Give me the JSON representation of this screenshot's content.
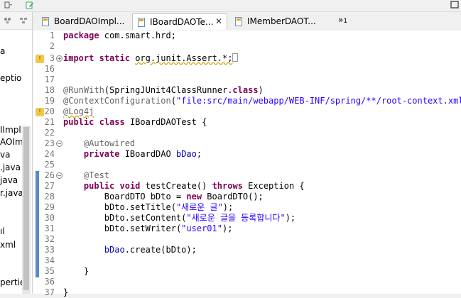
{
  "left_panel": {
    "items": [
      "a",
      "eptio",
      "IImpl.",
      "AOIm",
      "va",
      ".java",
      "java",
      "r.java",
      "ıl",
      "xml",
      "pertie"
    ]
  },
  "tabs": [
    {
      "label": "BoardDAOImpl...",
      "active": false
    },
    {
      "label": "IBoardDAOTe...",
      "active": true,
      "close": "✕"
    },
    {
      "label": "IMemberDAOT...",
      "active": false
    }
  ],
  "tab_overflow": {
    "symbol": "»",
    "count": "1"
  },
  "editor": {
    "lines": [
      {
        "num": "1"
      },
      {
        "num": "2"
      },
      {
        "num": "3"
      },
      {
        "num": "16"
      },
      {
        "num": "17"
      },
      {
        "num": "18"
      },
      {
        "num": "19"
      },
      {
        "num": "20"
      },
      {
        "num": "21"
      },
      {
        "num": "22"
      },
      {
        "num": "23"
      },
      {
        "num": "24"
      },
      {
        "num": "25"
      },
      {
        "num": "26"
      },
      {
        "num": "27"
      },
      {
        "num": "28"
      },
      {
        "num": "29"
      },
      {
        "num": "30"
      },
      {
        "num": "31"
      },
      {
        "num": "32"
      },
      {
        "num": "33"
      },
      {
        "num": "34"
      },
      {
        "num": "35"
      },
      {
        "num": "36"
      },
      {
        "num": "37"
      }
    ],
    "code": {
      "l1_kw": "package",
      "l1_rest": " com.smart.hrd;",
      "l3_kw1": "import",
      "l3_kw2": "static",
      "l3_rest": "org.junit.Assert.*;",
      "l18_ann": "@RunWith",
      "l18_rest": "(SpringJUnit4ClassRunner.",
      "l18_kw": "class",
      "l18_end": ")",
      "l19_ann": "@ContextConfiguration",
      "l19_open": "(",
      "l19_str": "\"file:src/main/webapp/WEB-INF/spring/**/root-context.xml\"",
      "l20_ann": "@Log4j",
      "l21_kw1": "public",
      "l21_kw2": "class",
      "l21_rest": " IBoardDAOTest {",
      "l23_ann": "@Autowired",
      "l24_kw": "private",
      "l24_type": " IBoardDAO ",
      "l24_fld": "bDao",
      "l24_end": ";",
      "l26_ann": "@Test",
      "l27_kw1": "public",
      "l27_kw2": "void",
      "l27_mid": " testCreate() ",
      "l27_kw3": "throws",
      "l27_end": " Exception {",
      "l28_a": "BoardDTO bDto = ",
      "l28_kw": "new",
      "l28_b": " BoardDTO();",
      "l29_a": "bDto.setTitle(",
      "l29_str": "\"새로운 글\"",
      "l29_b": ");",
      "l30_a": "bDto.setContent(",
      "l30_str": "\"새로운 글을 등록합니다\"",
      "l30_b": ");",
      "l31_a": "bDto.setWriter(",
      "l31_str": "\"user01\"",
      "l31_b": ");",
      "l33_fld": "bDao",
      "l33_b": ".create(bDto);",
      "l35": "}",
      "l37": "}"
    }
  },
  "colors": {
    "keyword": "#7f0055",
    "annotation": "#646464",
    "string": "#2a00ff",
    "field": "#0000c0",
    "change_marker": "#5b8ac5",
    "warning_icon": "#f2c84b"
  },
  "icons": [
    "save-icon",
    "edit-icon",
    "file-icon",
    "warning-icon",
    "fold-expand-icon",
    "fold-collapse-icon",
    "close-icon"
  ]
}
